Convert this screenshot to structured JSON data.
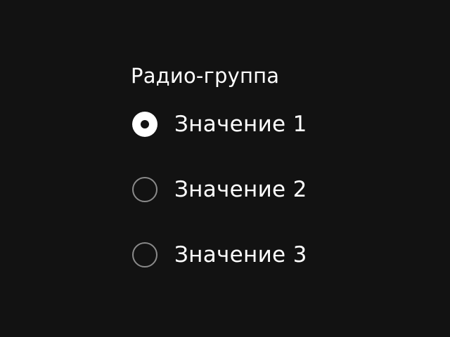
{
  "radio_group": {
    "label": "Радио-группа",
    "options": [
      {
        "label": "Значение 1",
        "checked": true
      },
      {
        "label": "Значение 2",
        "checked": false
      },
      {
        "label": "Значение 3",
        "checked": false
      }
    ]
  },
  "colors": {
    "background": "#121212",
    "text": "#ffffff",
    "radio_border_unchecked": "#8a8a8a",
    "radio_fill_checked": "#ffffff"
  },
  "icons": {
    "checked": "radio-checked-icon",
    "unchecked": "radio-unchecked-icon"
  }
}
